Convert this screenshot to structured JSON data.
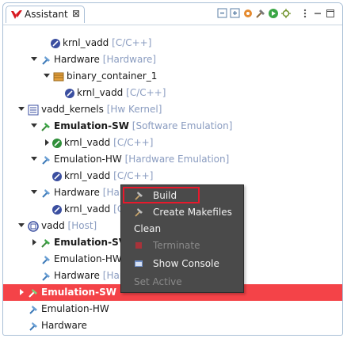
{
  "tab": {
    "title": "Assistant",
    "close_glyph": "⊠"
  },
  "toolbar": {
    "icons": [
      "collapse-all-icon",
      "expand-all-icon",
      "settings-icon",
      "build-icon",
      "run-icon",
      "debug-icon",
      "view-menu-icon",
      "minimize-icon",
      "maximize-icon"
    ]
  },
  "tree": [
    {
      "label": "krnl_vadd",
      "tag": "[C/C++]"
    },
    {
      "label": "Hardware",
      "tag": "[Hardware]"
    },
    {
      "label": "binary_container_1",
      "tag": ""
    },
    {
      "label": "krnl_vadd",
      "tag": "[C/C++]"
    },
    {
      "label": "vadd_kernels",
      "tag": "[Hw Kernel]"
    },
    {
      "label": "Emulation-SW",
      "tag": "[Software Emulation]"
    },
    {
      "label": "krnl_vadd",
      "tag": "[C/C++]"
    },
    {
      "label": "Emulation-HW",
      "tag": "[Hardware Emulation]"
    },
    {
      "label": "krnl_vadd",
      "tag": "[C/C++]"
    },
    {
      "label": "Hardware",
      "tag": "[Har"
    },
    {
      "label": "krnl_vadd",
      "tag": "[C"
    },
    {
      "label": "vadd",
      "tag": "[Host]"
    },
    {
      "label": "Emulation-SV",
      "tag": ""
    },
    {
      "label": "Emulation-HW",
      "tag": ""
    },
    {
      "label": "Hardware",
      "tag": "[Har"
    },
    {
      "label": "Emulation-SW",
      "tag": ""
    },
    {
      "label": "Emulation-HW",
      "tag": ""
    },
    {
      "label": "Hardware",
      "tag": ""
    }
  ],
  "context_menu": {
    "items": [
      {
        "label": "Build",
        "enabled": true
      },
      {
        "label": "Create Makefiles",
        "enabled": true
      },
      {
        "label": "Clean",
        "enabled": true
      },
      {
        "label": "Terminate",
        "enabled": false
      },
      {
        "label": "Show Console",
        "enabled": true
      },
      {
        "label": "Set Active",
        "enabled": false
      }
    ]
  },
  "colors": {
    "selection": "#f44348",
    "menu_bg": "#4a4a4a",
    "highlight_border": "#e8192c",
    "tag_text": "#8a9cc0"
  }
}
